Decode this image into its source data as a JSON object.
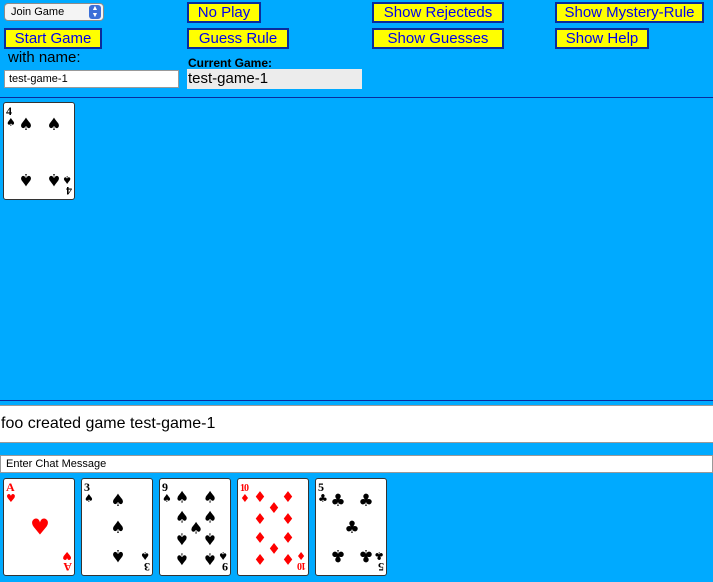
{
  "controls": {
    "mode_select": "Join Game",
    "buttons": {
      "no_play": "No Play",
      "show_rejecteds": "Show Rejecteds",
      "show_mystery_rule": "Show Mystery-Rule",
      "start_game": "Start Game",
      "guess_rule": "Guess Rule",
      "show_guesses": "Show Guesses",
      "show_help": "Show Help"
    },
    "with_name_label": "with name:",
    "name_value": "test-game-1",
    "current_game_label": "Current Game:",
    "current_game_value": "test-game-1"
  },
  "board": {
    "played_cards": [
      {
        "rank": "4",
        "suit": "spades"
      }
    ]
  },
  "log": {
    "message": "foo created game test-game-1"
  },
  "chat": {
    "value": "Enter Chat Message"
  },
  "hand": {
    "cards": [
      {
        "rank": "A",
        "suit": "hearts"
      },
      {
        "rank": "3",
        "suit": "spades"
      },
      {
        "rank": "9",
        "suit": "spades"
      },
      {
        "rank": "10",
        "suit": "diamonds"
      },
      {
        "rank": "5",
        "suit": "clubs"
      }
    ]
  },
  "colors": {
    "background": "#00aaff",
    "button_fill": "#ffff00",
    "button_border": "#0b2b9c",
    "button_text": "#0000ee",
    "red_suit": "#ff0000",
    "black_suit": "#000000"
  }
}
